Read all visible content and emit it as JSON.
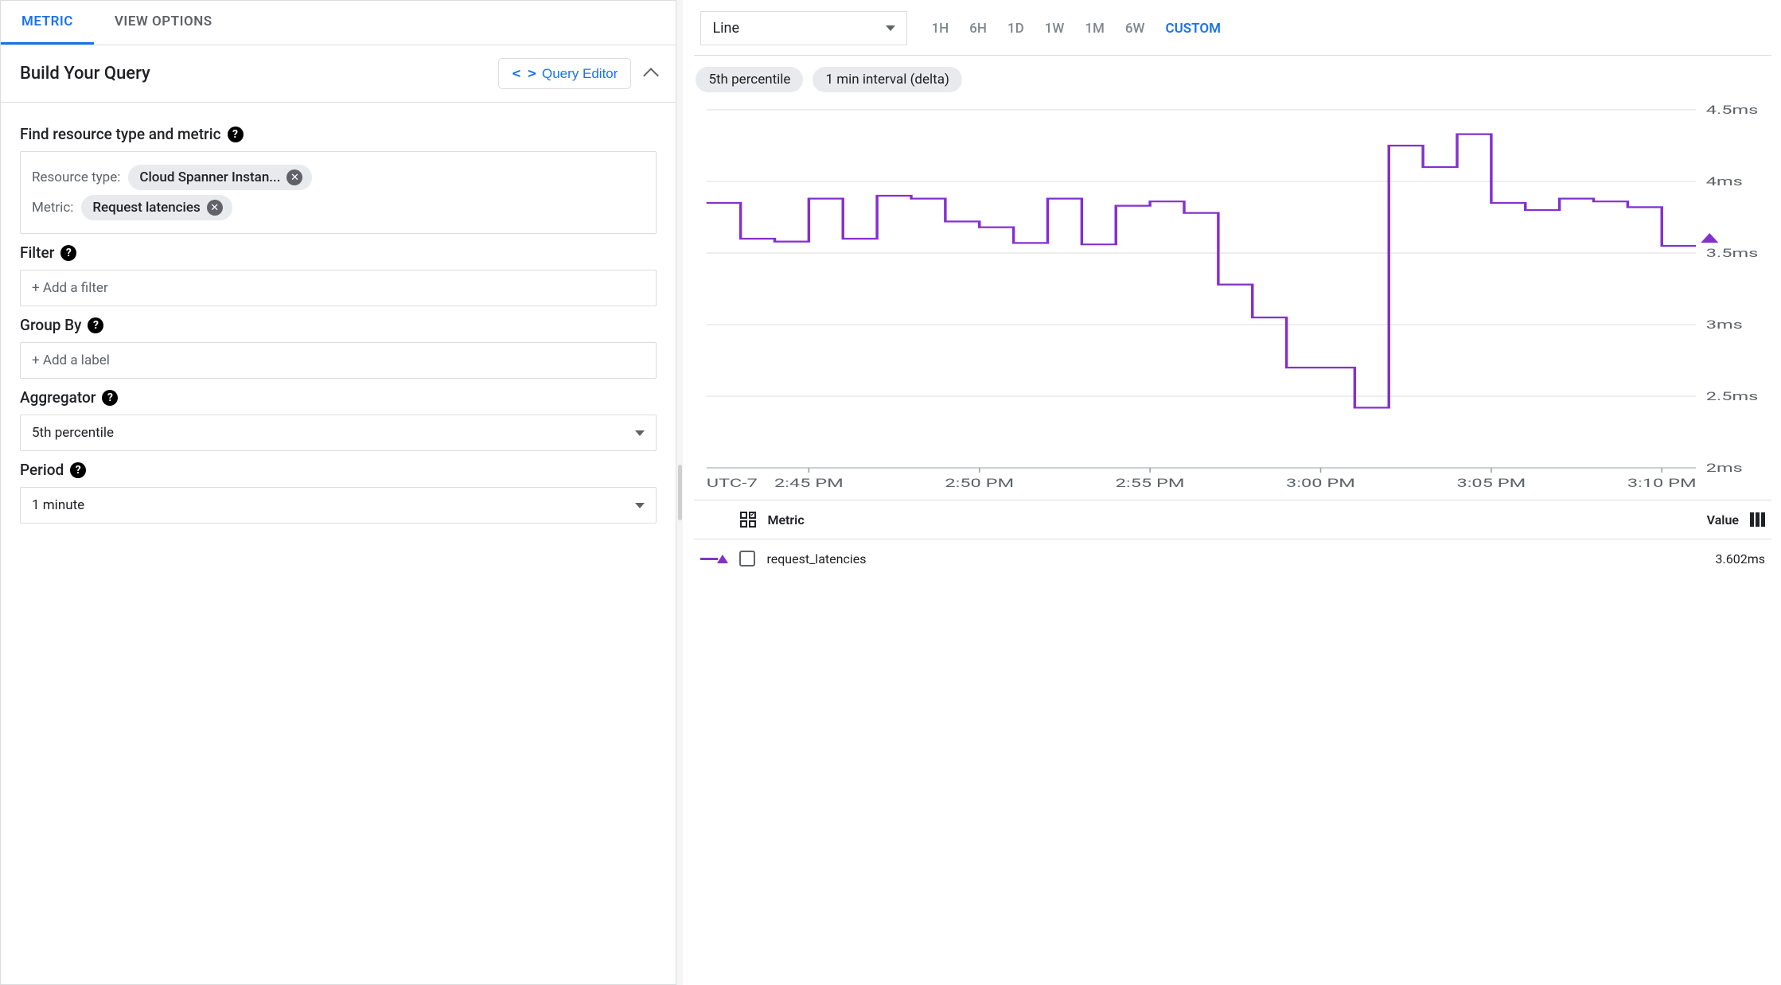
{
  "left": {
    "tabs": {
      "metric": "METRIC",
      "view_options": "VIEW OPTIONS"
    },
    "section_title": "Build Your Query",
    "query_editor_label": "Query Editor",
    "find_label": "Find resource type and metric",
    "resource_type_label": "Resource type:",
    "resource_type_value": "Cloud Spanner Instan...",
    "metric_label": "Metric:",
    "metric_value": "Request latencies",
    "filter_label": "Filter",
    "filter_placeholder": "+ Add a filter",
    "groupby_label": "Group By",
    "groupby_placeholder": "+ Add a label",
    "aggregator_label": "Aggregator",
    "aggregator_value": "5th percentile",
    "period_label": "Period",
    "period_value": "1 minute"
  },
  "top": {
    "chart_type": "Line",
    "ranges": [
      "1H",
      "6H",
      "1D",
      "1W",
      "1M",
      "6W",
      "CUSTOM"
    ],
    "range_active": "CUSTOM",
    "chip_percentile": "5th percentile",
    "chip_interval": "1 min interval (delta)"
  },
  "legend": {
    "metric_col": "Metric",
    "value_col": "Value",
    "series_name": "request_latencies",
    "series_value": "3.602ms"
  },
  "chart_data": {
    "type": "line",
    "title": "",
    "xlabel": "UTC-7",
    "ylabel": "",
    "ylim": [
      2.0,
      4.5
    ],
    "yticks": [
      2.0,
      2.5,
      3.0,
      3.5,
      4.0,
      4.5
    ],
    "ytick_labels": [
      "2ms",
      "2.5ms",
      "3ms",
      "3.5ms",
      "4ms",
      "4.5ms"
    ],
    "xlim": [
      0,
      29
    ],
    "xticks": [
      3,
      8,
      13,
      18,
      23,
      28
    ],
    "xtick_labels": [
      "2:45 PM",
      "2:50 PM",
      "2:55 PM",
      "3:00 PM",
      "3:05 PM",
      "3:10 PM"
    ],
    "series": [
      {
        "name": "request_latencies",
        "color": "#8430ce",
        "x": [
          0,
          1,
          2,
          3,
          4,
          5,
          6,
          7,
          8,
          9,
          10,
          11,
          12,
          13,
          14,
          15,
          16,
          17,
          18,
          19,
          20,
          21,
          22,
          23,
          24,
          25,
          26,
          27,
          28,
          29
        ],
        "y": [
          3.85,
          3.6,
          3.58,
          3.88,
          3.6,
          3.9,
          3.88,
          3.72,
          3.68,
          3.57,
          3.88,
          3.56,
          3.83,
          3.86,
          3.78,
          3.28,
          3.05,
          2.7,
          2.7,
          2.42,
          4.25,
          4.1,
          4.33,
          3.85,
          3.8,
          3.88,
          3.86,
          3.82,
          3.55,
          3.55
        ]
      }
    ],
    "marker_x": 29.4,
    "marker_y": 3.6
  }
}
